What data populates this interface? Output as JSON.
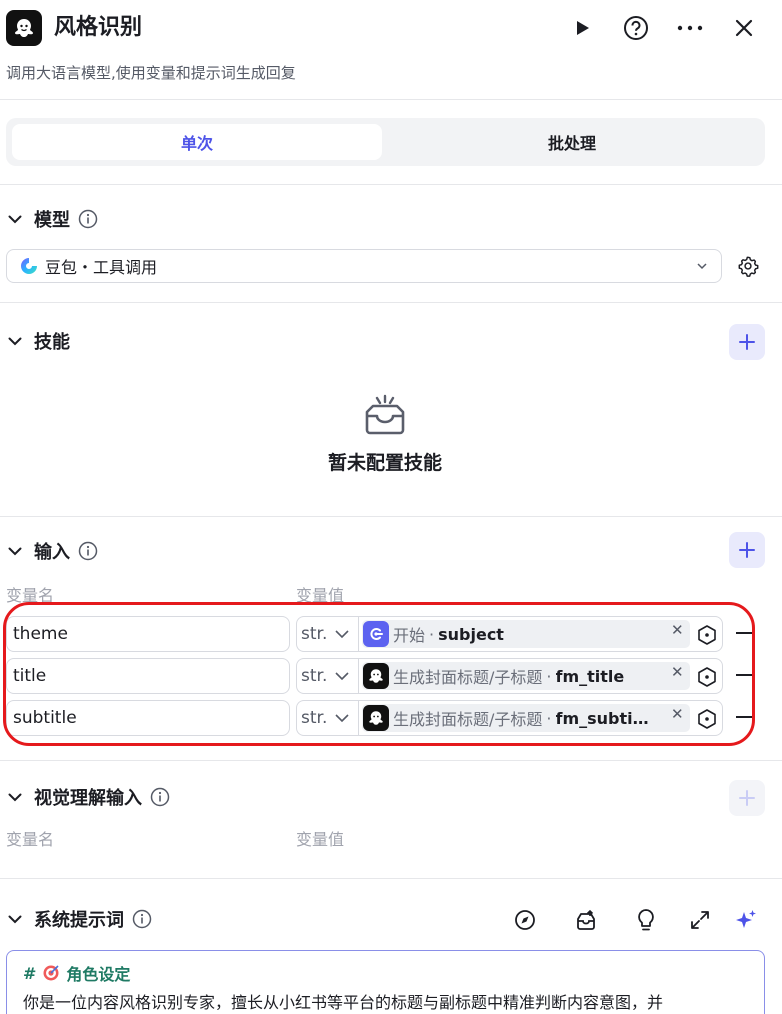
{
  "header": {
    "title": "风格识别",
    "description": "调用大语言模型,使用变量和提示词生成回复"
  },
  "tabs": [
    {
      "label": "单次",
      "active": true
    },
    {
      "label": "批处理",
      "active": false
    }
  ],
  "model": {
    "section_title": "模型",
    "selected": "豆包・工具调用"
  },
  "skills": {
    "section_title": "技能",
    "empty_text": "暂未配置技能"
  },
  "input": {
    "section_title": "输入",
    "col_name": "变量名",
    "col_value": "变量值",
    "rows": [
      {
        "name": "theme",
        "type": "str.",
        "node": "开始",
        "var": "subject",
        "node_icon": "start-icon"
      },
      {
        "name": "title",
        "type": "str.",
        "node": "生成封面标题/子标题",
        "var": "fm_title",
        "node_icon": "llm-node-icon"
      },
      {
        "name": "subtitle",
        "type": "str.",
        "node": "生成封面标题/子标题",
        "var": "fm_subti…",
        "node_icon": "llm-node-icon"
      }
    ],
    "separator": "·"
  },
  "visual_input": {
    "section_title": "视觉理解输入",
    "col_name": "变量名",
    "col_value": "变量值"
  },
  "system_prompt": {
    "section_title": "系统提示词",
    "heading_hash": "#",
    "heading": "角色设定",
    "body": "你是一位内容风格识别专家，擅长从小红书等平台的标题与副标题中精准判断内容意图，并"
  },
  "colors": {
    "accent": "#4d53e8",
    "highlight": "#e5191c",
    "start_node": "#5c62f0"
  }
}
